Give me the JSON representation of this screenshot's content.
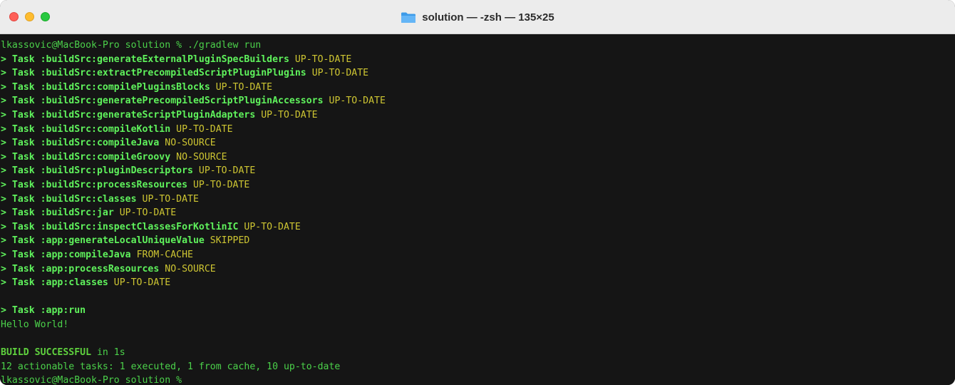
{
  "window": {
    "title": "solution — -zsh — 135×25",
    "folder_icon": "folder-icon",
    "controls": [
      "close-button",
      "minimize-button",
      "zoom-button"
    ]
  },
  "colors": {
    "terminal_bg": "#151515",
    "prompt_green": "#4bd14a",
    "task_green": "#5ff25c",
    "status_yellow": "#cdc532",
    "close": "#fe5f57",
    "minimize": "#febc2e",
    "zoom": "#28c840"
  },
  "terminal": {
    "prompt_start": "lkassovic@MacBook-Pro solution % ",
    "command": "./gradlew run",
    "tasks": [
      {
        "prefix": "> Task ",
        "name": ":buildSrc:generateExternalPluginSpecBuilders",
        "status": " UP-TO-DATE"
      },
      {
        "prefix": "> Task ",
        "name": ":buildSrc:extractPrecompiledScriptPluginPlugins",
        "status": " UP-TO-DATE"
      },
      {
        "prefix": "> Task ",
        "name": ":buildSrc:compilePluginsBlocks",
        "status": " UP-TO-DATE"
      },
      {
        "prefix": "> Task ",
        "name": ":buildSrc:generatePrecompiledScriptPluginAccessors",
        "status": " UP-TO-DATE"
      },
      {
        "prefix": "> Task ",
        "name": ":buildSrc:generateScriptPluginAdapters",
        "status": " UP-TO-DATE"
      },
      {
        "prefix": "> Task ",
        "name": ":buildSrc:compileKotlin",
        "status": " UP-TO-DATE"
      },
      {
        "prefix": "> Task ",
        "name": ":buildSrc:compileJava",
        "status": " NO-SOURCE"
      },
      {
        "prefix": "> Task ",
        "name": ":buildSrc:compileGroovy",
        "status": " NO-SOURCE"
      },
      {
        "prefix": "> Task ",
        "name": ":buildSrc:pluginDescriptors",
        "status": " UP-TO-DATE"
      },
      {
        "prefix": "> Task ",
        "name": ":buildSrc:processResources",
        "status": " UP-TO-DATE"
      },
      {
        "prefix": "> Task ",
        "name": ":buildSrc:classes",
        "status": " UP-TO-DATE"
      },
      {
        "prefix": "> Task ",
        "name": ":buildSrc:jar",
        "status": " UP-TO-DATE"
      },
      {
        "prefix": "> Task ",
        "name": ":buildSrc:inspectClassesForKotlinIC",
        "status": " UP-TO-DATE"
      },
      {
        "prefix": "> Task ",
        "name": ":app:generateLocalUniqueValue",
        "status": " SKIPPED"
      },
      {
        "prefix": "> Task ",
        "name": ":app:compileJava",
        "status": " FROM-CACHE"
      },
      {
        "prefix": "> Task ",
        "name": ":app:processResources",
        "status": " NO-SOURCE"
      },
      {
        "prefix": "> Task ",
        "name": ":app:classes",
        "status": " UP-TO-DATE"
      }
    ],
    "run_task": {
      "prefix": "> Task ",
      "name": ":app:run"
    },
    "program_output": "Hello World!",
    "build_result": {
      "bold": "BUILD SUCCESSFUL",
      "rest": " in 1s"
    },
    "summary": "12 actionable tasks: 1 executed, 1 from cache, 10 up-to-date",
    "prompt_end": "lkassovic@MacBook-Pro solution % "
  }
}
